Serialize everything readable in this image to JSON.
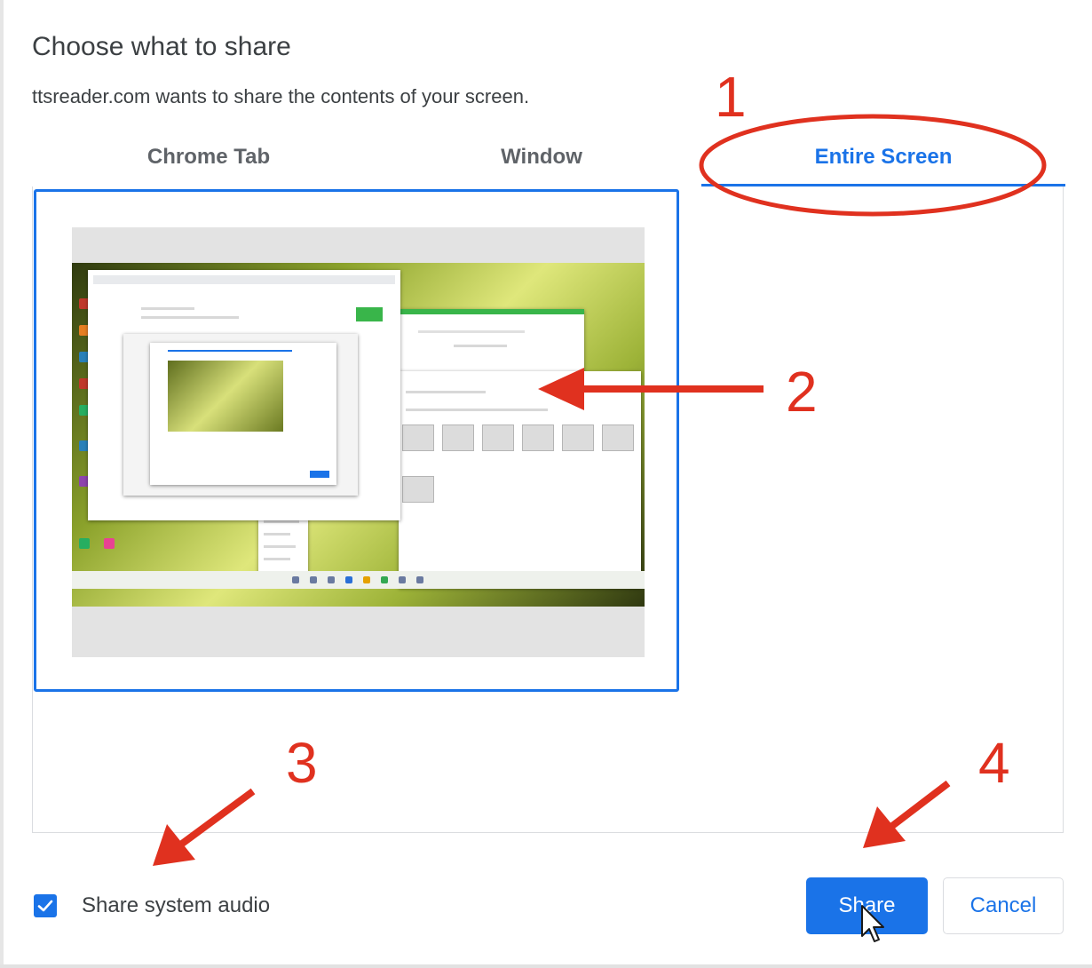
{
  "dialog": {
    "title": "Choose what to share",
    "subtitle": "ttsreader.com wants to share the contents of your screen."
  },
  "tabs": [
    {
      "label": "Chrome Tab",
      "selected": false
    },
    {
      "label": "Window",
      "selected": false
    },
    {
      "label": "Entire Screen",
      "selected": true
    }
  ],
  "share_audio": {
    "label": "Share system audio",
    "checked": true
  },
  "buttons": {
    "share": "Share",
    "cancel": "Cancel"
  },
  "annotations": [
    "1",
    "2",
    "3",
    "4"
  ],
  "colors": {
    "accent": "#1a73e8",
    "annotation": "#e0311f",
    "text": "#3c4043",
    "tab_text": "#5f6368"
  },
  "icons": {
    "checkbox": "checkmark-icon",
    "cursor": "mouse-pointer-icon"
  }
}
